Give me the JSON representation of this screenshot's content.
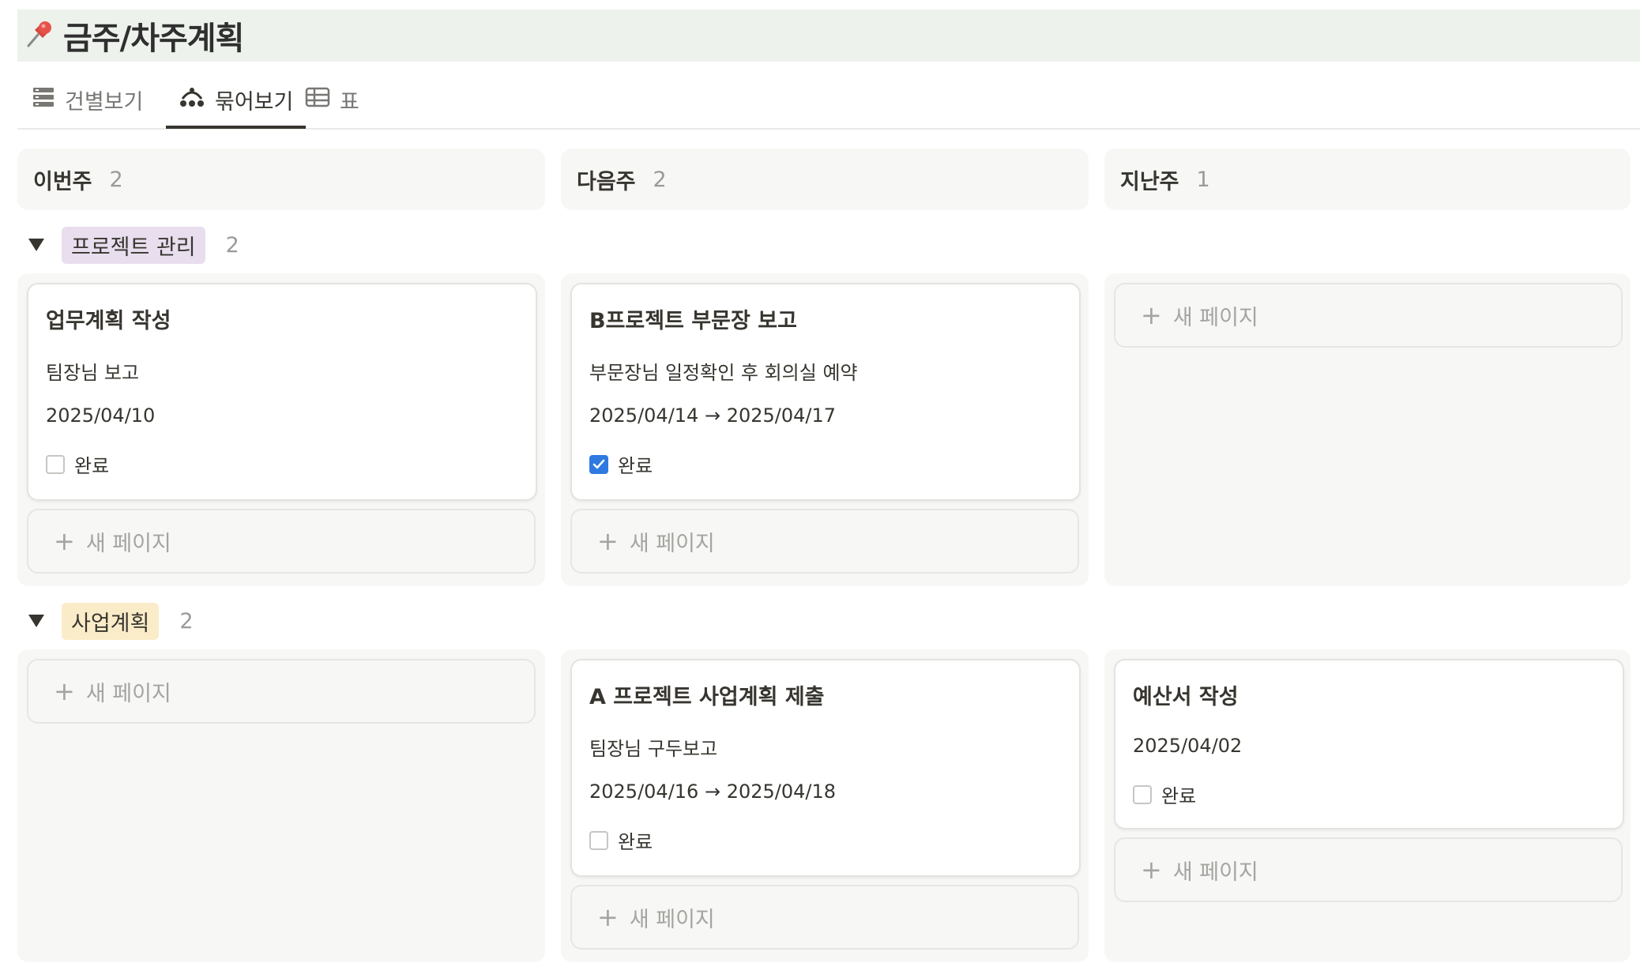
{
  "page": {
    "icon": "pushpin-icon",
    "title": "금주/차주계획",
    "title_bg": "#edf3ec"
  },
  "tabs": [
    {
      "label": "건별보기",
      "icon": "list-view-icon",
      "active": false
    },
    {
      "label": "묶어보기",
      "icon": "board-view-icon",
      "active": true
    },
    {
      "label": "표",
      "icon": "table-view-icon",
      "active": false
    }
  ],
  "columns": [
    {
      "title": "이번주",
      "count": "2"
    },
    {
      "title": "다음주",
      "count": "2"
    },
    {
      "title": "지난주",
      "count": "1"
    }
  ],
  "groups": [
    {
      "name": "프로젝트 관리",
      "count": "2",
      "tag_color": "#e8deee",
      "cards": [
        {
          "column": "이번주",
          "title": "업무계획 작성",
          "note": "팀장님 보고",
          "date": "2025/04/10",
          "done_label": "완료",
          "done": false
        },
        {
          "column": "다음주",
          "title": "B프로젝트 부문장 보고",
          "note": "부문장님 일정확인 후 회의실 예약",
          "date": "2025/04/14 → 2025/04/17",
          "done_label": "완료",
          "done": true
        }
      ]
    },
    {
      "name": "사업계획",
      "count": "2",
      "tag_color": "#fbecc9",
      "cards": [
        {
          "column": "다음주",
          "title": "A 프로젝트 사업계획 제출",
          "note": "팀장님 구두보고",
          "date": "2025/04/16 → 2025/04/18",
          "done_label": "완료",
          "done": false
        },
        {
          "column": "지난주",
          "title": "예산서 작성",
          "date": "2025/04/02",
          "done_label": "완료",
          "done": false
        }
      ]
    }
  ],
  "new_page_label": "새 페이지",
  "colors": {
    "accent_checkbox": "#2e7ae0",
    "lane_bg": "#f7f7f5",
    "text": "#37352f",
    "muted": "#9b9a97"
  }
}
